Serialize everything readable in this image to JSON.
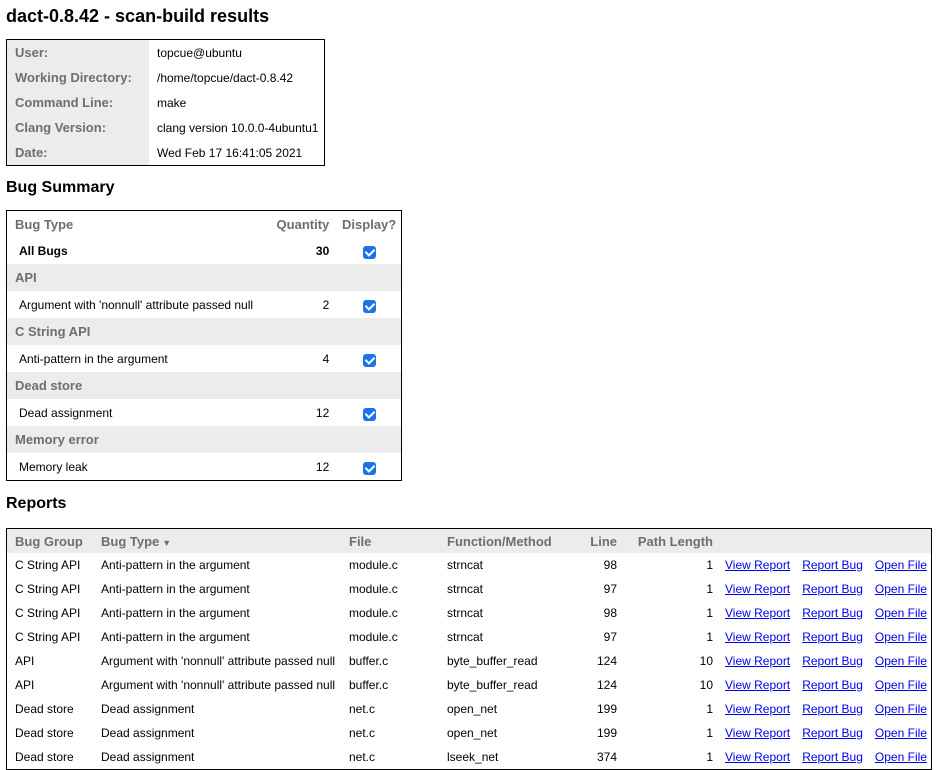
{
  "page": {
    "title": "dact-0.8.42 - scan-build results"
  },
  "info": [
    {
      "label": "User:",
      "value": "topcue@ubuntu"
    },
    {
      "label": "Working Directory:",
      "value": "/home/topcue/dact-0.8.42"
    },
    {
      "label": "Command Line:",
      "value": "make"
    },
    {
      "label": "Clang Version:",
      "value": "clang version 10.0.0-4ubuntu1"
    },
    {
      "label": "Date:",
      "value": "Wed Feb 17 16:41:05 2021"
    }
  ],
  "summary": {
    "heading": "Bug Summary",
    "columns": [
      "Bug Type",
      "Quantity",
      "Display?"
    ],
    "all": {
      "label": "All Bugs",
      "quantity": "30",
      "checked": true
    },
    "groups": [
      {
        "name": "API",
        "items": [
          {
            "label": "Argument with 'nonnull' attribute passed null",
            "quantity": "2",
            "checked": true
          }
        ]
      },
      {
        "name": "C String API",
        "items": [
          {
            "label": "Anti-pattern in the argument",
            "quantity": "4",
            "checked": true
          }
        ]
      },
      {
        "name": "Dead store",
        "items": [
          {
            "label": "Dead assignment",
            "quantity": "12",
            "checked": true
          }
        ]
      },
      {
        "name": "Memory error",
        "items": [
          {
            "label": "Memory leak",
            "quantity": "12",
            "checked": true
          }
        ]
      }
    ]
  },
  "reports": {
    "heading": "Reports",
    "columns": [
      "Bug Group",
      "Bug Type",
      "File",
      "Function/Method",
      "Line",
      "Path Length"
    ],
    "sort_icon": "sort-down-icon",
    "links": {
      "view": "View Report",
      "bug": "Report Bug",
      "open": "Open File"
    },
    "rows": [
      [
        "C String API",
        "Anti-pattern in the argument",
        "module.c",
        "strncat",
        "98",
        "1"
      ],
      [
        "C String API",
        "Anti-pattern in the argument",
        "module.c",
        "strncat",
        "97",
        "1"
      ],
      [
        "C String API",
        "Anti-pattern in the argument",
        "module.c",
        "strncat",
        "98",
        "1"
      ],
      [
        "C String API",
        "Anti-pattern in the argument",
        "module.c",
        "strncat",
        "97",
        "1"
      ],
      [
        "API",
        "Argument with 'nonnull' attribute passed null",
        "buffer.c",
        "byte_buffer_read",
        "124",
        "10"
      ],
      [
        "API",
        "Argument with 'nonnull' attribute passed null",
        "buffer.c",
        "byte_buffer_read",
        "124",
        "10"
      ],
      [
        "Dead store",
        "Dead assignment",
        "net.c",
        "open_net",
        "199",
        "1"
      ],
      [
        "Dead store",
        "Dead assignment",
        "net.c",
        "open_net",
        "199",
        "1"
      ],
      [
        "Dead store",
        "Dead assignment",
        "net.c",
        "lseek_net",
        "374",
        "1"
      ]
    ]
  },
  "colors": {
    "link": "#0000ee",
    "header_bg": "#ececec",
    "checkbox": "#1a73e8"
  }
}
